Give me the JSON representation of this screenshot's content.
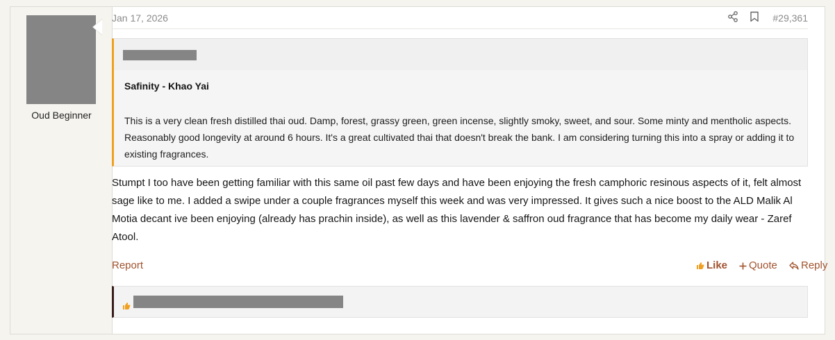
{
  "user": {
    "name": "Oud Beginner"
  },
  "post": {
    "date": "Jan 17, 2026",
    "number": "#29,361",
    "quote": {
      "title": "Safinity - Khao Yai",
      "body": "This is a very clean fresh distilled thai oud. Damp, forest, grassy green, green incense, slightly smoky, sweet, and sour. Some minty and mentholic aspects. Reasonably good longevity at around 6 hours. It's a great cultivated thai that doesn't break the bank. I am considering turning this into a spray or adding it to existing fragrances."
    },
    "body": "Stumpt I too have been getting familiar with this same oil past few days and have been enjoying the fresh camphoric resinous aspects of it, felt almost sage like to me. I added a swipe under a couple fragrances myself this week and was very impressed. It gives such a nice boost to the ALD Malik Al Motia decant ive been enjoying (already has prachin inside), as well as this lavender & saffron oud fragrance that has become my daily wear - Zaref Atool."
  },
  "actions": {
    "report": "Report",
    "like": "Like",
    "quote": "Quote",
    "reply": "Reply"
  },
  "icons": {
    "share": "share-icon",
    "bookmark": "bookmark-icon",
    "like": "thumbs-up-icon",
    "quote": "plus-icon",
    "reply": "reply-icon"
  },
  "colors": {
    "accent": "#a0522d",
    "quote_border": "#f0a020",
    "reactions_border": "#3a1e1e"
  }
}
